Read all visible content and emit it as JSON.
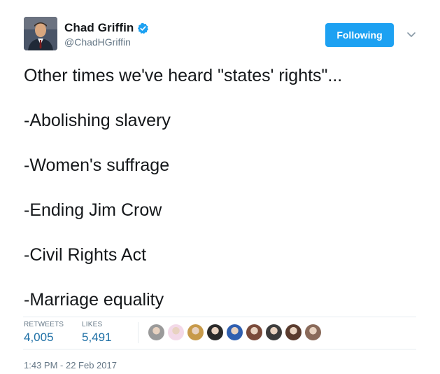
{
  "author": {
    "display_name": "Chad Griffin",
    "handle": "@ChadHGriffin",
    "verified_icon": "verified-badge-icon"
  },
  "follow_button": {
    "label": "Following"
  },
  "caret_icon": "chevron-down-icon",
  "tweet": {
    "lines": [
      "Other times we've heard \"states' rights\"...",
      "-Abolishing slavery",
      "-Women's suffrage",
      "-Ending Jim Crow",
      "-Civil Rights Act",
      "-Marriage equality"
    ]
  },
  "stats": {
    "retweets_label": "RETWEETS",
    "retweets_value": "4,005",
    "likes_label": "LIKES",
    "likes_value": "5,491"
  },
  "likers": [
    {
      "color": "#9a9a9a"
    },
    {
      "color": "#f3d9e8"
    },
    {
      "color": "#c79a4a"
    },
    {
      "color": "#2a2a2a"
    },
    {
      "color": "#2f5fb0"
    },
    {
      "color": "#7a4a3a"
    },
    {
      "color": "#3c3c3c"
    },
    {
      "color": "#5a3b2e"
    },
    {
      "color": "#8a6a5a"
    }
  ],
  "timestamp": "1:43 PM - 22 Feb 2017",
  "colors": {
    "accent": "#1da1f2",
    "text": "#14171a",
    "muted": "#657786"
  }
}
